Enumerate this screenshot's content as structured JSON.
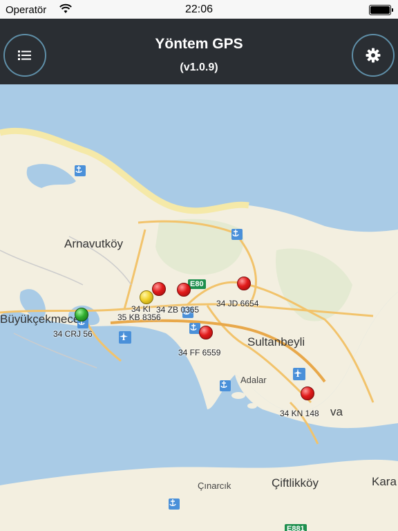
{
  "status_bar": {
    "carrier": "Operatör",
    "time": "22:06"
  },
  "header": {
    "title": "Yöntem GPS",
    "version": "(v1.0.9)"
  },
  "buttons": {
    "menu_icon": "list-icon",
    "settings_icon": "gear-icon"
  },
  "map": {
    "places": {
      "arnavutkoy": "Arnavutköy",
      "buyukcekmece": "Büyükçekmece",
      "sultanbeyli": "Sultanbeyli",
      "adalar": "Adalar",
      "tuzla": "va",
      "cinarcik": "Çınarcık",
      "ciftlikkoy": "Çiftlikköy",
      "kara": "Kara"
    },
    "road_shields": {
      "e80": "E80",
      "e881": "E881"
    },
    "vehicles": [
      {
        "plate": "34 KI",
        "status": "red"
      },
      {
        "plate": "34 ZB 0365",
        "status": "red"
      },
      {
        "plate": "34 JD 6654",
        "status": "red"
      },
      {
        "plate": "35 KB 8356",
        "status": "yellow"
      },
      {
        "plate": "34 CRJ 56",
        "status": "green"
      },
      {
        "plate": "34 FF 6559",
        "status": "red"
      },
      {
        "plate": "34 KN 148",
        "status": "red"
      }
    ]
  },
  "colors": {
    "navbar": "#2a2e33",
    "sea": "#a9cbe6",
    "land": "#f3efe0",
    "road": "#f2c36b",
    "marker_red": "#e11b1b",
    "marker_yellow": "#f1d12a",
    "marker_green": "#2fae2f"
  }
}
